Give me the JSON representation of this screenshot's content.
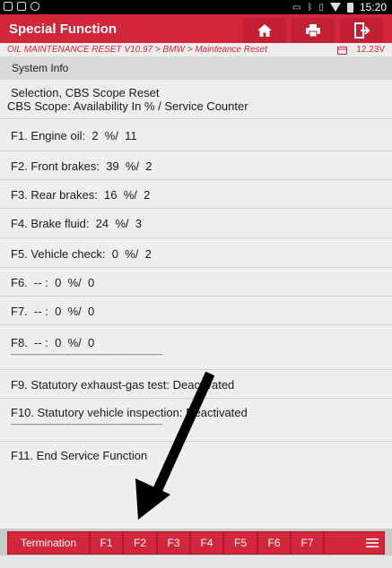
{
  "status_bar": {
    "time": "15:20"
  },
  "header": {
    "title": "Special Function"
  },
  "breadcrumb": {
    "path": "OIL MAINTENANCE RESET V10.97 > BMW > Mainteance Reset",
    "voltage": "12.23V"
  },
  "section": {
    "title": "System Info"
  },
  "rows": [
    {
      "lines": [
        "Selection, CBS Scope Reset",
        "CBS Scope: Availability In % / Service Counter"
      ]
    },
    {
      "lines": [
        "F1. Engine oil:  2  %/  11"
      ]
    },
    {
      "lines": [
        "F2. Front brakes:  39  %/  2"
      ]
    },
    {
      "lines": [
        "F3. Rear brakes:  16  %/  2"
      ]
    },
    {
      "lines": [
        "F4. Brake fluid:  24  %/  3"
      ]
    },
    {
      "lines": [
        "F5. Vehicle check:  0  %/  2"
      ]
    },
    {
      "lines": [
        "F6.  -- :  0  %/  0"
      ]
    },
    {
      "lines": [
        "F7.  -- :  0  %/  0"
      ]
    },
    {
      "lines": [
        "F8.  -- :  0  %/  0"
      ]
    },
    {
      "lines": [
        "F9. Statutory exhaust-gas test: Deactivated"
      ]
    },
    {
      "lines": [
        "F10. Statutory vehicle inspection: Deactivated"
      ]
    },
    {
      "lines": [
        "F11. End Service Function"
      ]
    }
  ],
  "toolbar": {
    "termination": "Termination",
    "f1": "F1",
    "f2": "F2",
    "f3": "F3",
    "f4": "F4",
    "f5": "F5",
    "f6": "F6",
    "f7": "F7"
  },
  "icons": [
    "home-icon",
    "print-icon",
    "exit-icon",
    "menu-icon",
    "calendar-icon"
  ],
  "colors": {
    "brand_red": "#d3263a",
    "background": "#eeeeee"
  }
}
